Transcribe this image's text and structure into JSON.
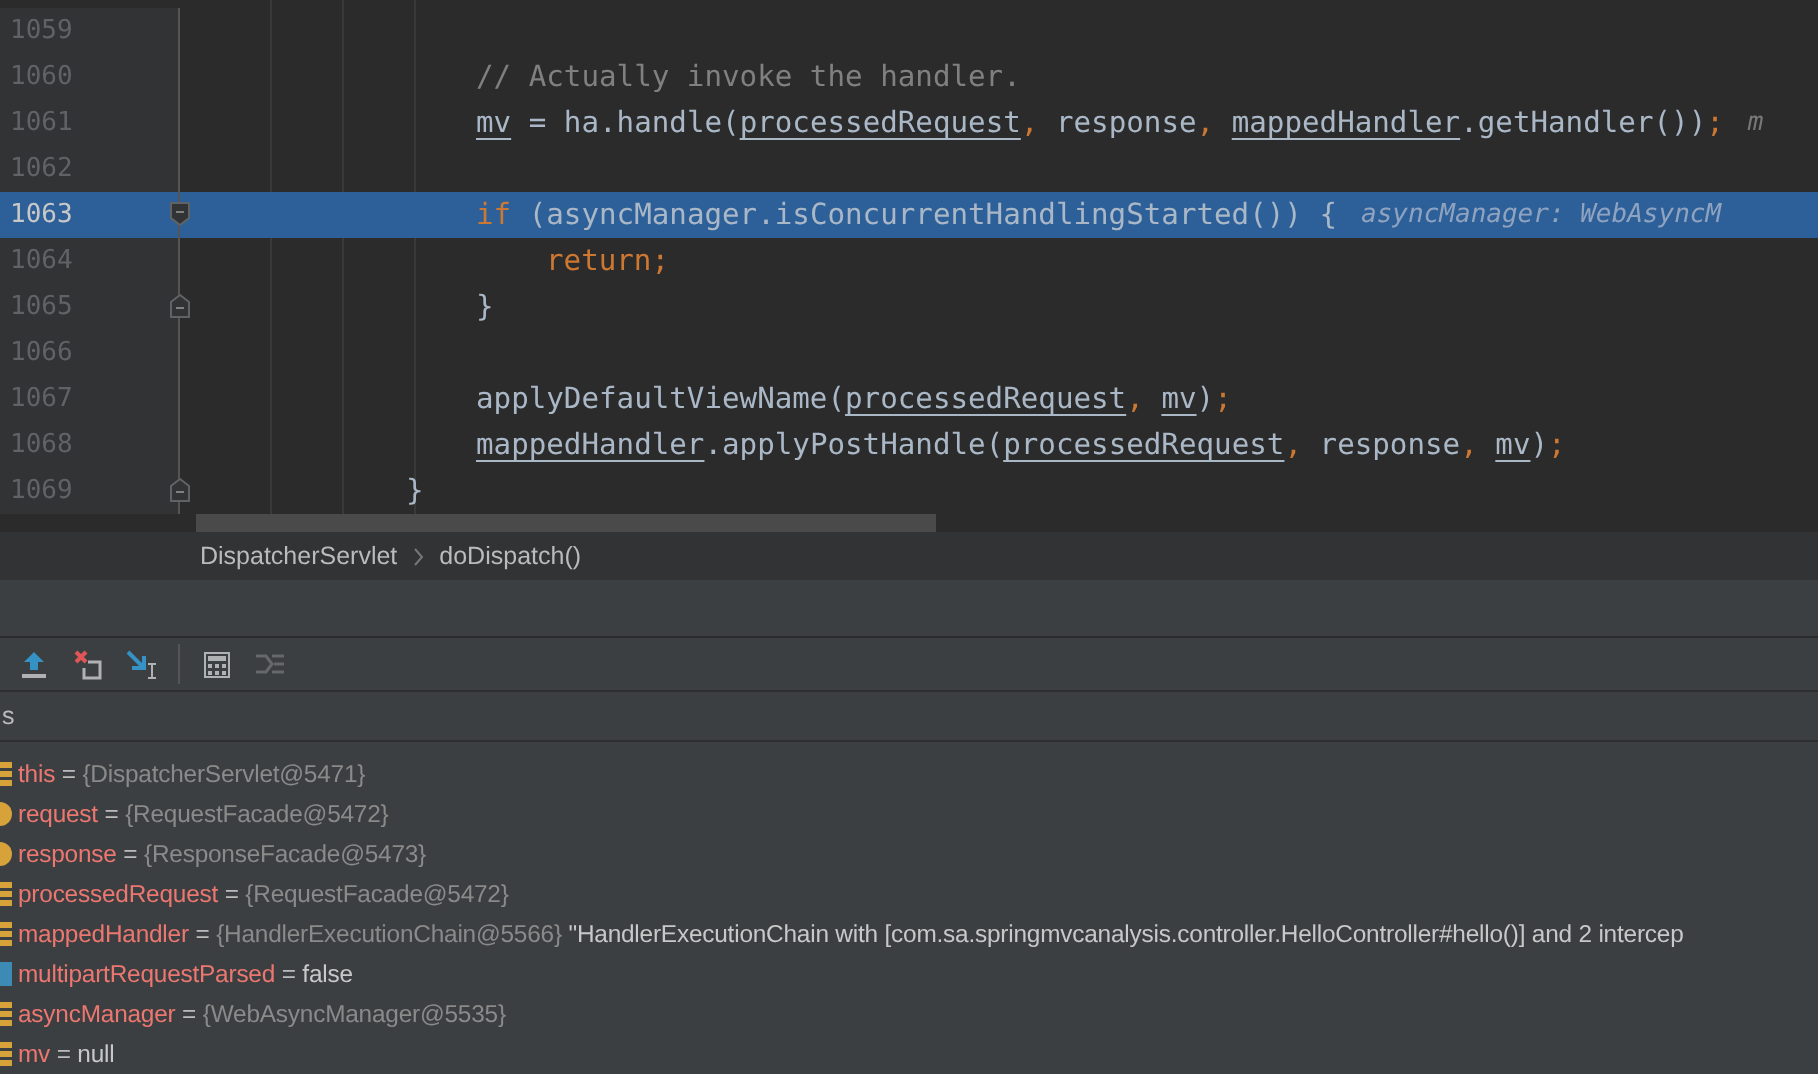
{
  "editor": {
    "lines": [
      {
        "children": [
          {
            "number": "1059",
            "kind": "plain",
            "selected": false
          },
          {
            "number": "1060",
            "kind": "plain",
            "selected": false,
            "tokens": [
              {
                "kind": "comment",
                "t": "// Actually invoke the handler."
              }
            ]
          },
          {
            "number": "1061",
            "kind": "plain",
            "selected": false,
            "tokens": [
              {
                "kind": "var",
                "t": "mv"
              },
              {
                "kind": "plain",
                "t": " = ha.handle("
              },
              {
                "kind": "var",
                "t": "processedRequest"
              },
              {
                "kind": "keyword",
                "t": ", "
              },
              {
                "kind": "plain",
                "t": "response"
              },
              {
                "kind": "keyword",
                "t": ", "
              },
              {
                "kind": "var",
                "t": "mappedHandler"
              },
              {
                "kind": "plain",
                "t": ".getHandler())"
              },
              {
                "kind": "keyword",
                "t": ";"
              }
            ],
            "hint": "m"
          },
          {
            "number": "1062",
            "kind": "plain",
            "selected": false
          },
          {
            "number": "1063",
            "kind": "block-start",
            "selected": true,
            "tokens": [
              {
                "kind": "keyword",
                "t": "if"
              },
              {
                "kind": "plain",
                "t": " (asyncManager.isConcurrentHandlingStarted()) {"
              }
            ],
            "hint": "asyncManager: WebAsyncM",
            "children": [
              {
                "number": "1064",
                "kind": "plain",
                "selected": false,
                "tokens": [
                  {
                    "kind": "keyword",
                    "t": "return;"
                  }
                ]
              }
            ]
          },
          {
            "number": "1065",
            "kind": "block-end",
            "selected": false,
            "tokens": [
              {
                "kind": "plain",
                "t": "}"
              }
            ]
          },
          {
            "number": "1066",
            "kind": "plain",
            "selected": false
          },
          {
            "number": "1067",
            "kind": "plain",
            "selected": false,
            "tokens": [
              {
                "kind": "plain",
                "t": "applyDefaultViewName("
              },
              {
                "kind": "var",
                "t": "processedRequest"
              },
              {
                "kind": "keyword",
                "t": ", "
              },
              {
                "kind": "var",
                "t": "mv"
              },
              {
                "kind": "plain",
                "t": ")"
              },
              {
                "kind": "keyword",
                "t": ";"
              }
            ]
          },
          {
            "number": "1068",
            "kind": "plain",
            "selected": false,
            "tokens": [
              {
                "kind": "var",
                "t": "mappedHandler"
              },
              {
                "kind": "plain",
                "t": ".applyPostHandle("
              },
              {
                "kind": "var",
                "t": "processedRequest"
              },
              {
                "kind": "keyword",
                "t": ", "
              },
              {
                "kind": "plain",
                "t": "response"
              },
              {
                "kind": "keyword",
                "t": ", "
              },
              {
                "kind": "var",
                "t": "mv"
              },
              {
                "kind": "plain",
                "t": ")"
              },
              {
                "kind": "keyword",
                "t": ";"
              }
            ]
          }
        ]
      },
      {
        "number": "1069",
        "kind": "block-end",
        "selected": false,
        "tokens": [
          {
            "kind": "plain",
            "t": "}"
          }
        ]
      }
    ]
  },
  "breadcrumb": [
    "DispatcherServlet",
    "doDispatch()"
  ],
  "toolbar": [
    {
      "kind": "step-out",
      "disabled": false
    },
    {
      "kind": "drop-frame",
      "disabled": false
    },
    {
      "kind": "run-to-cursor",
      "disabled": false
    },
    {
      "kind": "separator"
    },
    {
      "kind": "evaluate",
      "disabled": false
    },
    {
      "kind": "trace",
      "disabled": true
    }
  ],
  "panel_title": "s",
  "variables": [
    {
      "kind": "field",
      "name": "this",
      "operator": "=",
      "value": {
        "kind": "object",
        "text": "{DispatcherServlet@5471}"
      }
    },
    {
      "kind": "param",
      "name": "request",
      "operator": "=",
      "value": {
        "kind": "object",
        "text": "{RequestFacade@5472}"
      }
    },
    {
      "kind": "param",
      "name": "response",
      "operator": "=",
      "value": {
        "kind": "object",
        "text": "{ResponseFacade@5473}"
      }
    },
    {
      "kind": "field",
      "name": "processedRequest",
      "operator": "=",
      "value": {
        "kind": "object",
        "text": "{RequestFacade@5472}"
      }
    },
    {
      "kind": "field",
      "name": "mappedHandler",
      "operator": "=",
      "value": {
        "kind": "object",
        "text": "{HandlerExecutionChain@5566}"
      },
      "detail": "\"HandlerExecutionChain with [com.sa.springmvcanalysis.controller.HelloController#hello()] and 2 intercep"
    },
    {
      "kind": "primitive",
      "name": "multipartRequestParsed",
      "operator": "=",
      "value": {
        "kind": "literal",
        "text": "false"
      }
    },
    {
      "kind": "field",
      "name": "asyncManager",
      "operator": "=",
      "value": {
        "kind": "object",
        "text": "{WebAsyncManager@5535}"
      }
    },
    {
      "kind": "field",
      "name": "mv",
      "operator": "=",
      "value": {
        "kind": "literal",
        "text": "null"
      }
    }
  ]
}
